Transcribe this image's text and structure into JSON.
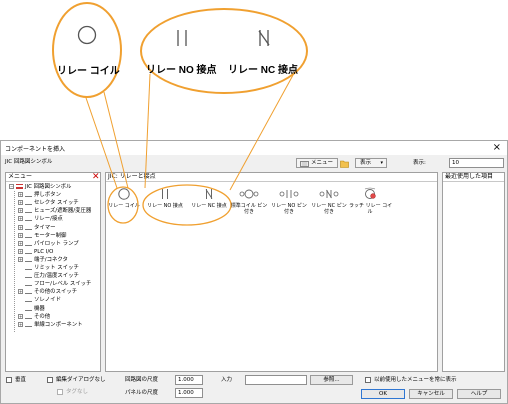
{
  "callouts": [
    {
      "label": "リレー コイル"
    },
    {
      "label": "リレー NO 接点"
    },
    {
      "label": "リレー NC 接点"
    }
  ],
  "dialog": {
    "title": "コンポーネントを挿入",
    "close_label": "×",
    "subtitle": "JIC 回路図シンボル",
    "toolbar": {
      "menu_label": "メニュー",
      "display_label": "表示",
      "display_size_label": "表示:",
      "display_size_value": "10"
    },
    "menu_panel": {
      "header": "メニュー",
      "items": [
        {
          "label": "JIC 回路図シンボル",
          "expand": "−"
        },
        {
          "label": "押しボタン",
          "expand": "+"
        },
        {
          "label": "セレクタ スイッチ",
          "expand": "+"
        },
        {
          "label": "ヒューズ/遮断器/変圧器",
          "expand": "+"
        },
        {
          "label": "リレー/接点",
          "expand": "+"
        },
        {
          "label": "タイマー",
          "expand": "+"
        },
        {
          "label": "モーター制御",
          "expand": "+"
        },
        {
          "label": "パイロット ランプ",
          "expand": "+"
        },
        {
          "label": "PLC I/O",
          "expand": "+"
        },
        {
          "label": "端子/コネクタ",
          "expand": "+"
        },
        {
          "label": "リミット スイッチ",
          "expand": ""
        },
        {
          "label": "圧力/温度スイッチ",
          "expand": ""
        },
        {
          "label": "フロー/レベル スイッチ",
          "expand": ""
        },
        {
          "label": "その他のスイッチ",
          "expand": "+"
        },
        {
          "label": "ソレノイド",
          "expand": ""
        },
        {
          "label": "機器",
          "expand": ""
        },
        {
          "label": "その他",
          "expand": "+"
        },
        {
          "label": "単線コンポーネント",
          "expand": "+"
        }
      ]
    },
    "components_panel": {
      "header": "JIC: リレーと接点",
      "components": [
        {
          "label": "リレー コイル",
          "label2": "",
          "icon": "relay-coil-icon"
        },
        {
          "label": "リレー NO 接点",
          "label2": "",
          "icon": "relay-no-contact-icon"
        },
        {
          "label": "リレー NC 接点",
          "label2": "",
          "icon": "relay-nc-contact-icon"
        },
        {
          "label": "標準コイル ピン",
          "label2": "付き",
          "icon": "standard-coil-pin-icon"
        },
        {
          "label": "リレー NO ピン",
          "label2": "付き",
          "icon": "relay-no-pin-icon"
        },
        {
          "label": "リレー NC ピン",
          "label2": "付き",
          "icon": "relay-nc-pin-icon"
        },
        {
          "label": "ラッチ リレー コイ",
          "label2": "ル",
          "icon": "latch-relay-coil-icon"
        }
      ]
    },
    "recent_panel": {
      "header": "最近使用した項目"
    },
    "bottom": {
      "vertical_label": "垂直",
      "no_edit_dialog_label": "編集ダイアログなし",
      "no_tag_label": "タグなし",
      "scale_label": "回路図の尺度",
      "scale_value": "1.000",
      "panel_scale_label": "パネルの尺度",
      "panel_scale_value": "1.000",
      "input_label": "入力",
      "input_value": "",
      "browse_label": "参照...",
      "always_show_label": "以前使用したメニューを常に表示",
      "ok_label": "OK",
      "cancel_label": "キャンセル",
      "help_label": "ヘルプ"
    }
  },
  "colors": {
    "callout_accent": "#f0a030",
    "close_accent": "#cc0000",
    "ok_border": "#2f76d2",
    "window_bg": "#f0f0f0"
  }
}
